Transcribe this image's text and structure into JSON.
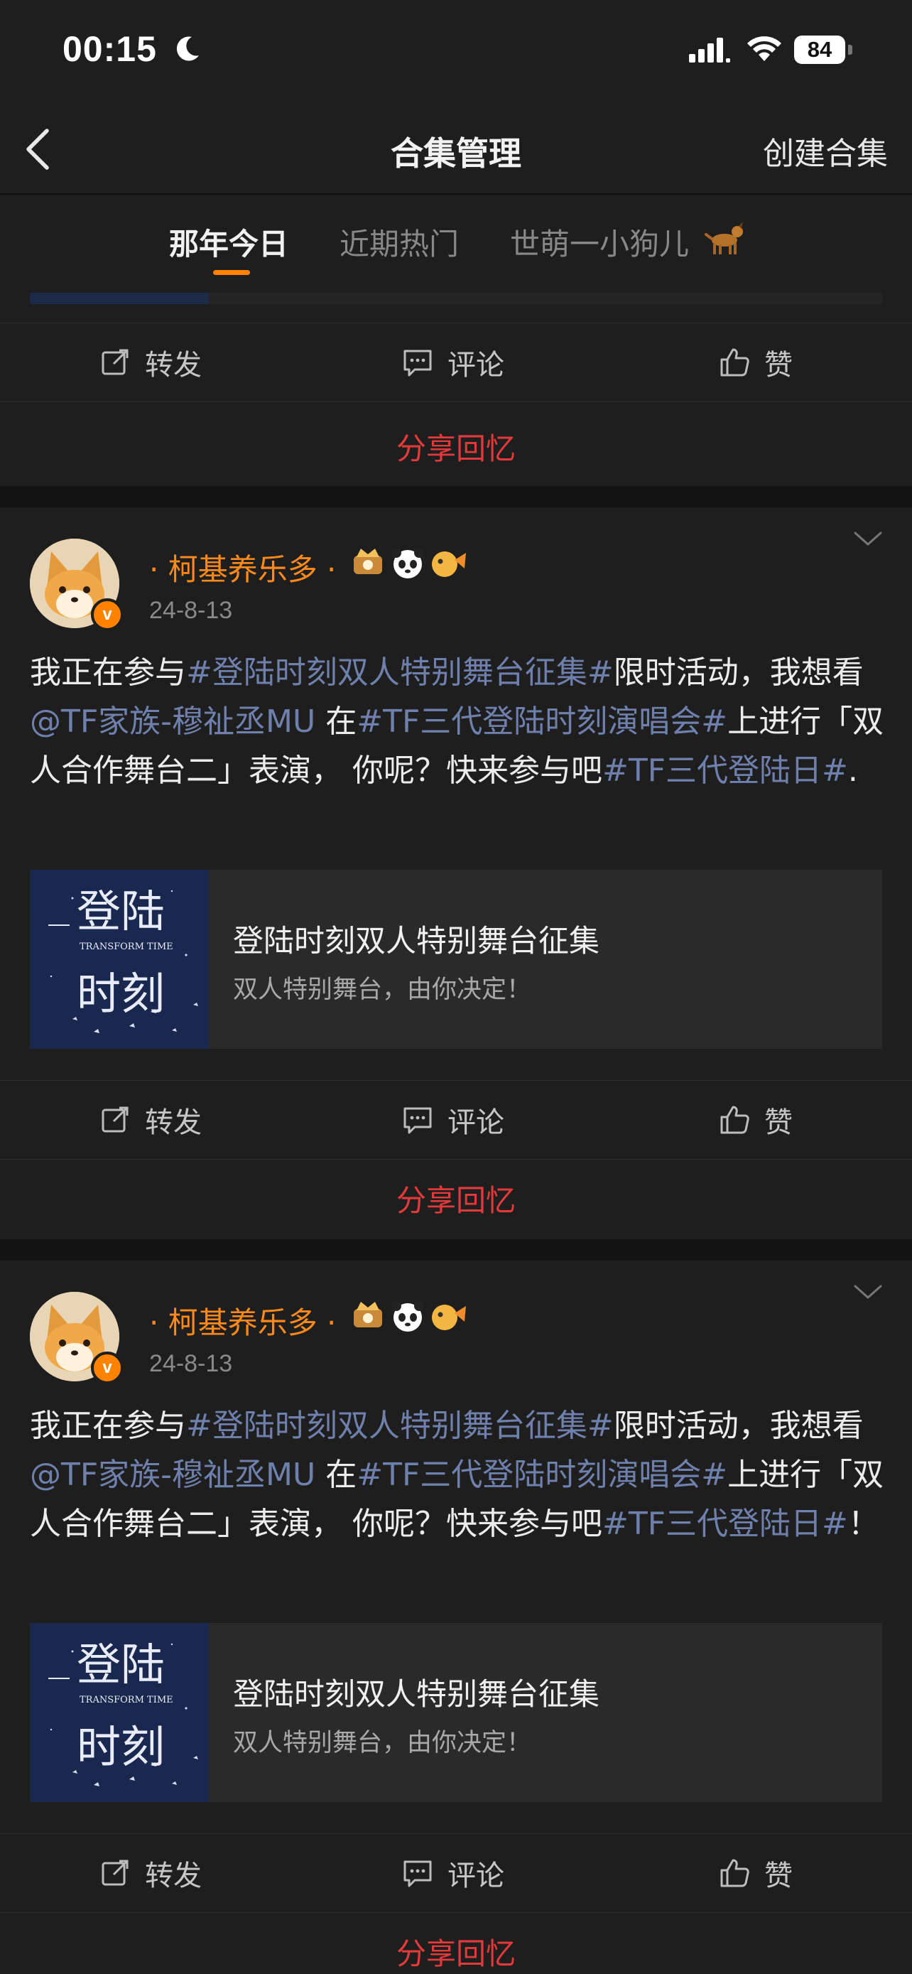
{
  "status_bar": {
    "time": "00:15",
    "battery": "84"
  },
  "nav": {
    "title": "合集管理",
    "create": "创建合集"
  },
  "tabs": [
    {
      "label": "那年今日"
    },
    {
      "label": "近期热门"
    },
    {
      "label": "世萌一小狗儿"
    }
  ],
  "actions": {
    "repost": "转发",
    "comment": "评论",
    "like": "赞",
    "share": "分享回忆"
  },
  "posts": [
    {
      "user": "· 柯基养乐多 ·",
      "date": "24-8-13",
      "body": {
        "p1": "我正在参与",
        "h1": "#登陆时刻双人特别舞台征集#",
        "p2": "限时活动，我想看",
        "h2": "@TF家族-穆祉丞MU",
        "p3": " 在",
        "h3": "#TF三代登陆时刻演唱会#",
        "p4": "上进行「双人合作舞台二」表演， 你呢？快来参与吧",
        "h4": "#TF三代登陆日#",
        "p5": "."
      },
      "card_title": "登陆时刻双人特别舞台征集",
      "card_subtitle": "双人特别舞台，由你决定！",
      "thumb_text": {
        "t1": "登陆",
        "t2": "TRANSFORM TIME",
        "t3": "时刻"
      }
    },
    {
      "user": "· 柯基养乐多 ·",
      "date": "24-8-13",
      "body": {
        "p1": "我正在参与",
        "h1": "#登陆时刻双人特别舞台征集#",
        "p2": "限时活动，我想看",
        "h2": "@TF家族-穆祉丞MU",
        "p3": " 在",
        "h3": "#TF三代登陆时刻演唱会#",
        "p4": "上进行「双人合作舞台二」表演， 你呢？快来参与吧",
        "h4": "#TF三代登陆日#",
        "p5": "！"
      },
      "card_title": "登陆时刻双人特别舞台征集",
      "card_subtitle": "双人特别舞台，由你决定！",
      "thumb_text": {
        "t1": "登陆",
        "t2": "TRANSFORM TIME",
        "t3": "时刻"
      }
    }
  ],
  "colors": {
    "accent": "#ff8200",
    "hashtag": "#6f80ad",
    "share": "#e23a3a",
    "background": "#1e1e1e"
  }
}
